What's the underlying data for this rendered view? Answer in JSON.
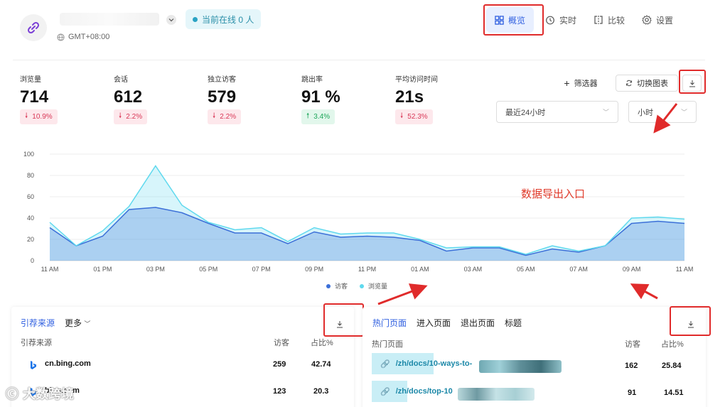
{
  "header": {
    "timezone": "GMT+08:00",
    "online": "当前在线 0 人",
    "nav": [
      {
        "label": "概览",
        "icon": "dashboard-icon",
        "active": true
      },
      {
        "label": "实时",
        "icon": "clock-icon",
        "active": false
      },
      {
        "label": "比较",
        "icon": "compare-icon",
        "active": false
      },
      {
        "label": "设置",
        "icon": "gear-icon",
        "active": false
      }
    ]
  },
  "metrics": [
    {
      "label": "浏览量",
      "value": "714",
      "change": "10.9%",
      "direction": "down"
    },
    {
      "label": "会话",
      "value": "612",
      "change": "2.2%",
      "direction": "down"
    },
    {
      "label": "独立访客",
      "value": "579",
      "change": "2.2%",
      "direction": "down"
    },
    {
      "label": "跳出率",
      "value": "91 %",
      "change": "3.4%",
      "direction": "up"
    },
    {
      "label": "平均访问时间",
      "value": "21s",
      "change": "52.3%",
      "direction": "down"
    }
  ],
  "toolbar": {
    "filter": "筛选器",
    "switch_chart": "切换图表",
    "range": "最近24小时",
    "granularity": "小时"
  },
  "annotation": "数据导出入口",
  "chart_data": {
    "type": "area",
    "x": [
      "11 AM",
      "12 PM",
      "01 PM",
      "02 PM",
      "03 PM",
      "04 PM",
      "05 PM",
      "06 PM",
      "07 PM",
      "08 PM",
      "09 PM",
      "10 PM",
      "11 PM",
      "12 AM",
      "01 AM",
      "02 AM",
      "03 AM",
      "04 AM",
      "05 AM",
      "06 AM",
      "07 AM",
      "08 AM",
      "09 AM",
      "10 AM",
      "11 AM"
    ],
    "tick_labels": [
      "11 AM",
      "01 PM",
      "03 PM",
      "05 PM",
      "07 PM",
      "09 PM",
      "11 PM",
      "01 AM",
      "03 AM",
      "05 AM",
      "07 AM",
      "09 AM",
      "11 AM"
    ],
    "series": [
      {
        "name": "访客",
        "color": "#3b6fd8",
        "values": [
          31,
          14,
          23,
          48,
          50,
          45,
          35,
          26,
          26,
          16,
          27,
          22,
          23,
          22,
          19,
          9,
          12,
          12,
          5,
          11,
          8,
          14,
          35,
          37,
          35
        ]
      },
      {
        "name": "浏览量",
        "color": "#5fd9ee",
        "values": [
          36,
          14,
          28,
          51,
          89,
          52,
          36,
          29,
          31,
          18,
          31,
          25,
          26,
          26,
          20,
          12,
          13,
          13,
          6,
          14,
          9,
          14,
          40,
          41,
          39
        ]
      }
    ],
    "ylim": [
      0,
      100
    ],
    "yticks": [
      0,
      20,
      40,
      60,
      80,
      100
    ],
    "grid": true,
    "legend": "bottom"
  },
  "referrers": {
    "tabs": [
      "引荐来源",
      "更多"
    ],
    "columns": [
      "引荐来源",
      "访客",
      "占比%"
    ],
    "rows": [
      {
        "name": "cn.bing.com",
        "visitors": "259",
        "percent": "42.74"
      },
      {
        "name": "bing.com",
        "visitors": "123",
        "percent": "20.3"
      }
    ]
  },
  "pages": {
    "tabs": [
      "热门页面",
      "进入页面",
      "退出页面",
      "标题"
    ],
    "columns": [
      "热门页面",
      "访客",
      "占比%"
    ],
    "rows": [
      {
        "path": "/zh/docs/10-ways-to-",
        "visitors": "162",
        "percent": "25.84"
      },
      {
        "path": "/zh/docs/top-10",
        "visitors": "91",
        "percent": "14.51"
      }
    ]
  },
  "watermark": "大数跨境"
}
